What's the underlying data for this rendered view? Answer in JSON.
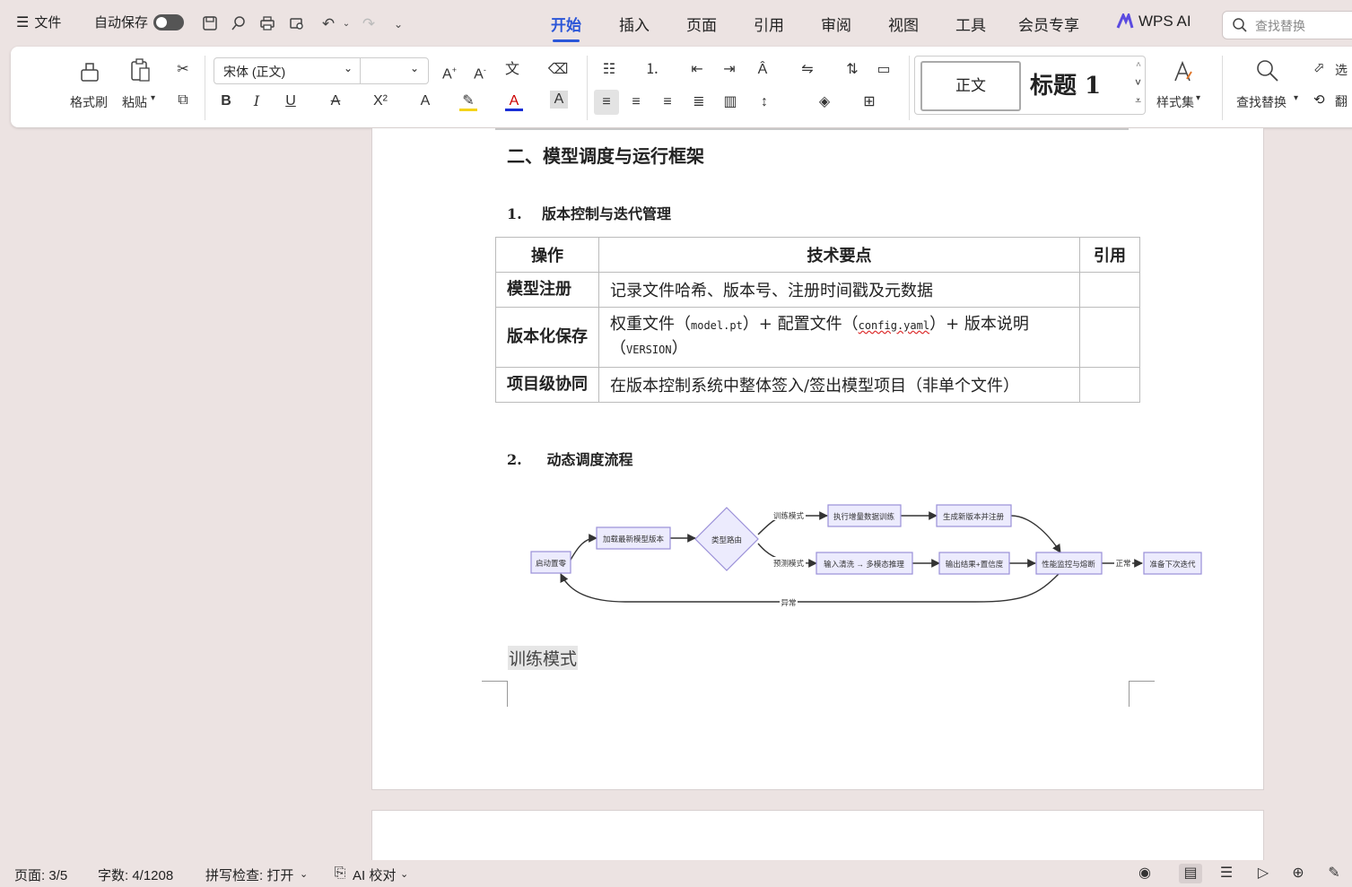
{
  "titlebar": {
    "menu_label": "文件",
    "autosave_label": "自动保存",
    "tabs": [
      "开始",
      "插入",
      "页面",
      "引用",
      "审阅",
      "视图",
      "工具",
      "会员专享",
      "WPS AI"
    ],
    "search_placeholder": "查找替换"
  },
  "ribbon": {
    "format_painter": "格式刷",
    "paste": "粘贴",
    "font_name": "宋体 (正文)",
    "font_size": "",
    "style_normal": "正文",
    "style_h1": "标题 1",
    "style_set": "样式集",
    "find_replace": "查找替换",
    "select": "选",
    "translate": "翻"
  },
  "document": {
    "section_title": "二、模型调度与运行框架",
    "sub1": "1.    版本控制与迭代管理",
    "table_headers": [
      "操作",
      "技术要点",
      "引用"
    ],
    "rows": [
      {
        "op": "模型注册",
        "pt": "记录文件哈希、版本号、注册时间戳及元数据",
        "ref": ""
      },
      {
        "op": "版本化保存",
        "pt_a": "权重文件（",
        "pt_m1": "model.pt",
        "pt_b": "）+ 配置文件（",
        "pt_m2": "config.yaml",
        "pt_c": "）+ 版本说明（",
        "pt_m3": "VERSION",
        "pt_d": "）",
        "ref": ""
      },
      {
        "op": "项目级协同",
        "pt": "在版本控制系统中整体签入/签出模型项目（非单个文件）",
        "ref": ""
      }
    ],
    "sub2": "2.     动态调度流程",
    "flow": {
      "start": "启动置零",
      "load": "加载最新模型版本",
      "router": "类型路由",
      "train_edge": "训练模式",
      "predict_edge": "预测模式",
      "train_exec": "执行增量数据训练",
      "register": "生成新版本并注册",
      "input": "输入清洗 → 多模态推理",
      "output": "输出结果+置信度",
      "monitor": "性能监控与熔断",
      "normal_edge": "正常",
      "next": "准备下次迭代",
      "abnormal_edge": "异常"
    },
    "selected_text": "训练模式"
  },
  "statusbar": {
    "page": "页面: 3/5",
    "words": "字数: 4/1208",
    "spell": "拼写检查: 打开",
    "ai_check": "AI 校对"
  },
  "colors": {
    "accent": "#2b56d8",
    "flow_node_fill": "#ecebfd",
    "flow_node_stroke": "#9a8fd8"
  }
}
